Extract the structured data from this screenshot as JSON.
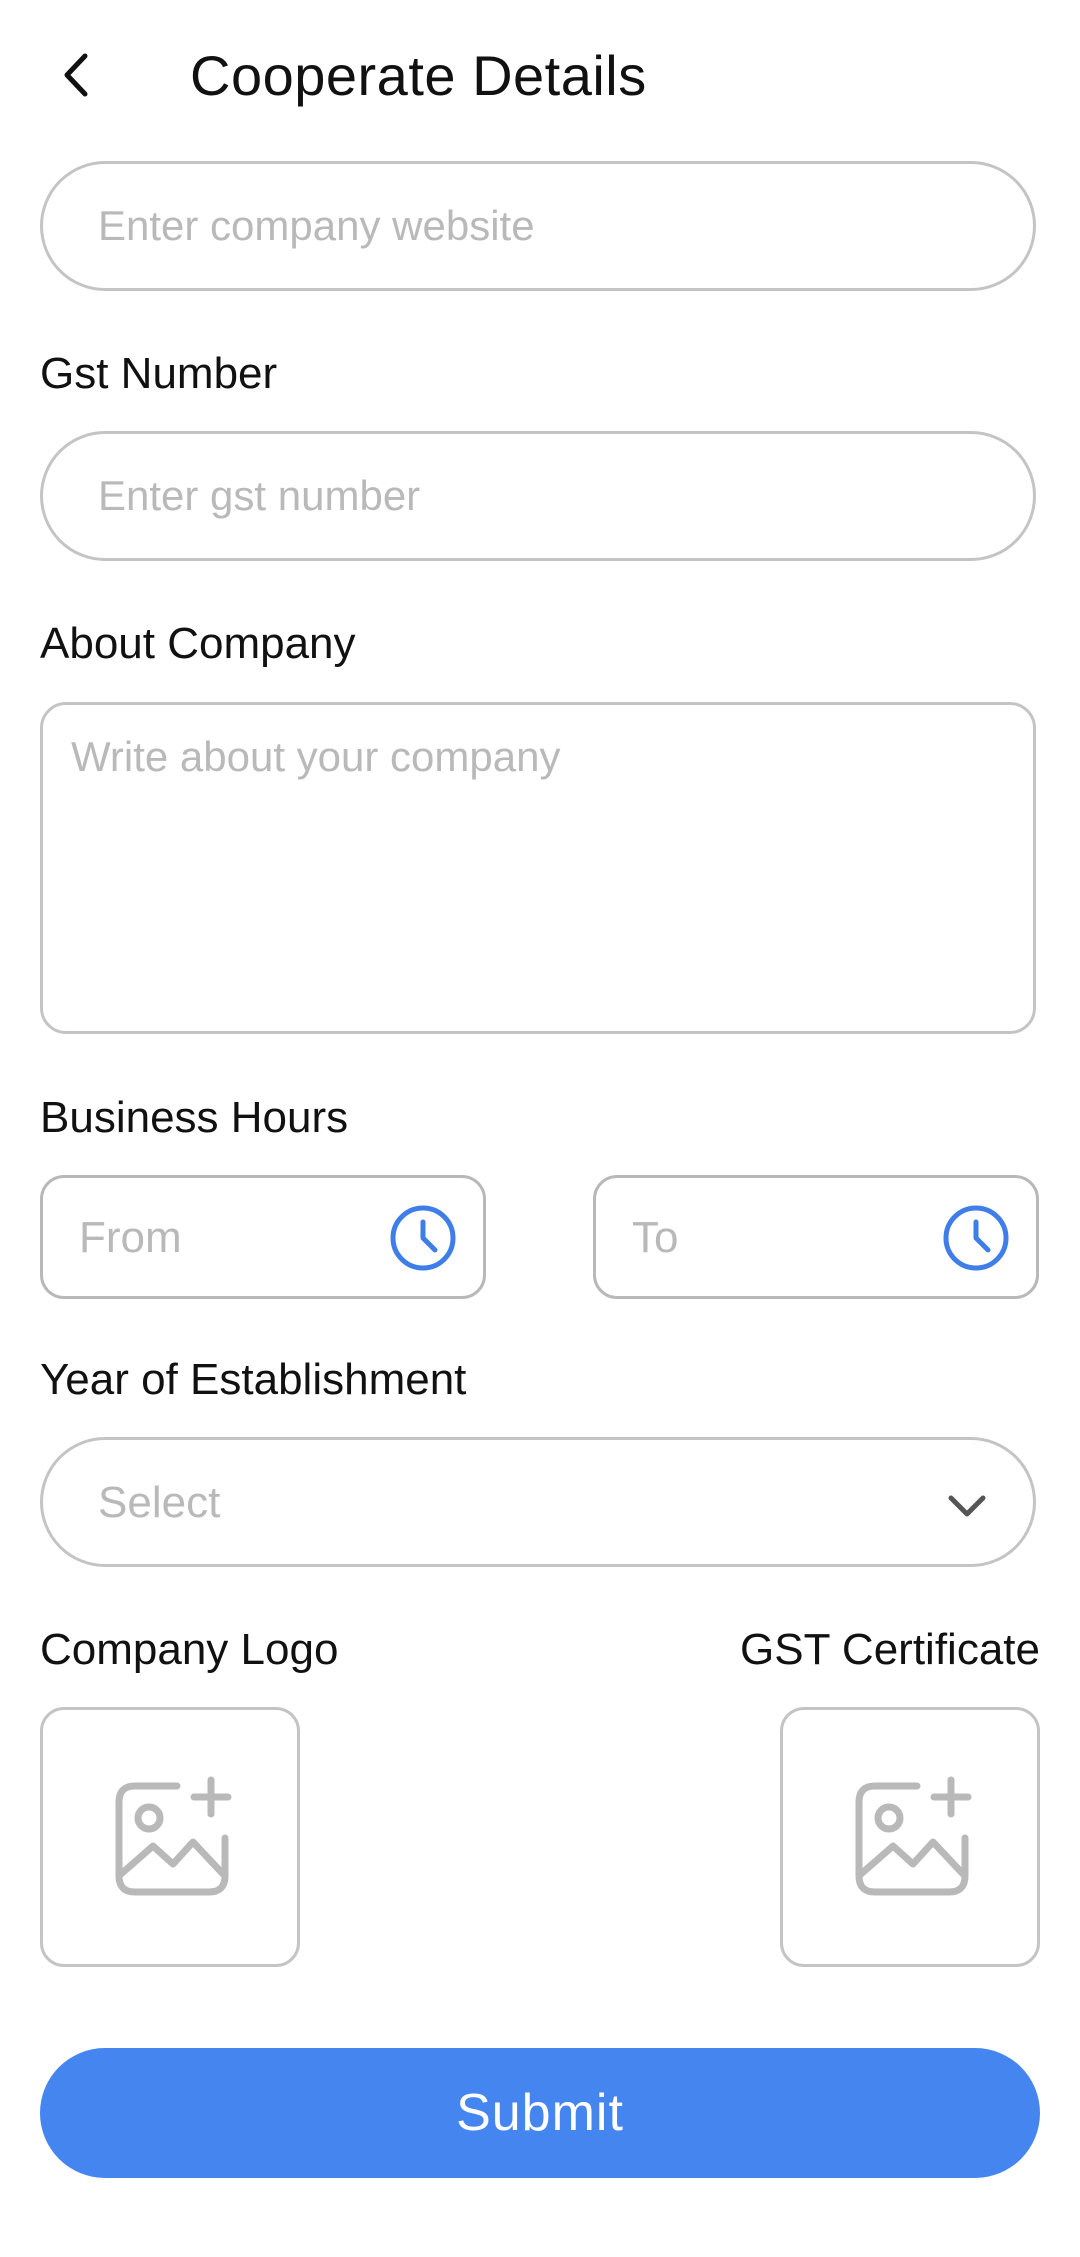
{
  "header": {
    "title": "Cooperate Details",
    "back_icon": "chevron-left-icon"
  },
  "website": {
    "placeholder": "Enter company website"
  },
  "gst_number": {
    "label": "Gst Number",
    "placeholder": "Enter gst number"
  },
  "about_company": {
    "label": "About Company",
    "placeholder": "Write about your company"
  },
  "business_hours": {
    "label": "Business Hours",
    "from_placeholder": "From",
    "to_placeholder": "To",
    "icon": "clock-icon",
    "icon_color": "#3f7ee8"
  },
  "year_of_establishment": {
    "label": "Year of Establishment",
    "selected": "Select",
    "icon": "chevron-down-icon"
  },
  "uploads": {
    "company_logo_label": "Company Logo",
    "gst_certificate_label": "GST Certificate",
    "icon": "add-image-icon"
  },
  "submit": {
    "label": "Submit",
    "color": "#4585f0"
  }
}
